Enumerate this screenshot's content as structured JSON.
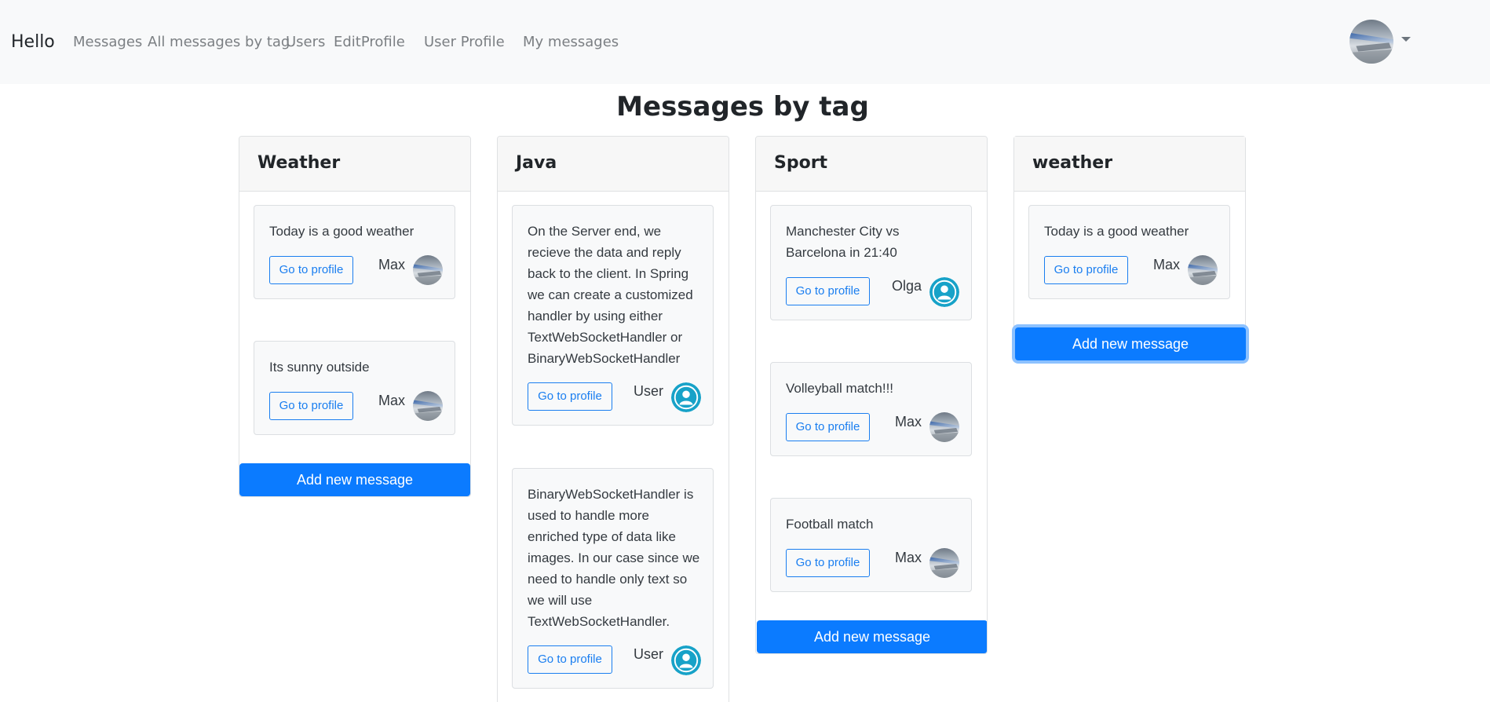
{
  "navbar": {
    "brand": "Hello",
    "links": [
      "Messages",
      "All messages by tag",
      "Users",
      "EditProfile",
      "User Profile",
      "My messages"
    ],
    "user_avatar_icon": "user-photo-avatar",
    "dropdown_icon": "caret-down-icon"
  },
  "page": {
    "title": "Messages by tag"
  },
  "columns": [
    {
      "tag": "Weather",
      "messages": [
        {
          "text": "Today is a good weather",
          "button": "Go to profile",
          "author": "Max",
          "avatar": "photo-avatar"
        },
        {
          "text": "Its sunny outside",
          "button": "Go to profile",
          "author": "Max",
          "avatar": "photo-avatar"
        }
      ],
      "add_button": "Add new message"
    },
    {
      "tag": "Java",
      "messages": [
        {
          "text": "On the Server end, we recieve the data and reply back to the client. In Spring we can create a customized handler by using either TextWebSocketHandler or BinaryWebSocketHandler",
          "button": "Go to profile",
          "author": "User",
          "avatar": "default-user-avatar"
        },
        {
          "text": "BinaryWebSocketHandler is used to handle more enriched type of data like images. In our case since we need to handle only text so we will use TextWebSocketHandler.",
          "button": "Go to profile",
          "author": "User",
          "avatar": "default-user-avatar"
        }
      ]
    },
    {
      "tag": "Sport",
      "messages": [
        {
          "text": "Manchester City vs Barcelona in 21:40",
          "button": "Go to profile",
          "author": "Olga",
          "avatar": "default-user-avatar"
        },
        {
          "text": "Volleyball match!!!",
          "button": "Go to profile",
          "author": "Max",
          "avatar": "photo-avatar"
        },
        {
          "text": "Football match",
          "button": "Go to profile",
          "author": "Max",
          "avatar": "photo-avatar"
        }
      ],
      "add_button": "Add new message"
    },
    {
      "tag": "weather",
      "messages": [
        {
          "text": "Today is a good weather",
          "button": "Go to profile",
          "author": "Max",
          "avatar": "photo-avatar"
        }
      ],
      "add_button": "Add new message"
    }
  ],
  "colors": {
    "primary": "#0b7bff",
    "outline_primary": "#1a7ef0",
    "navbar_bg": "#f8f9fa",
    "default_avatar": "#17a2c8"
  }
}
